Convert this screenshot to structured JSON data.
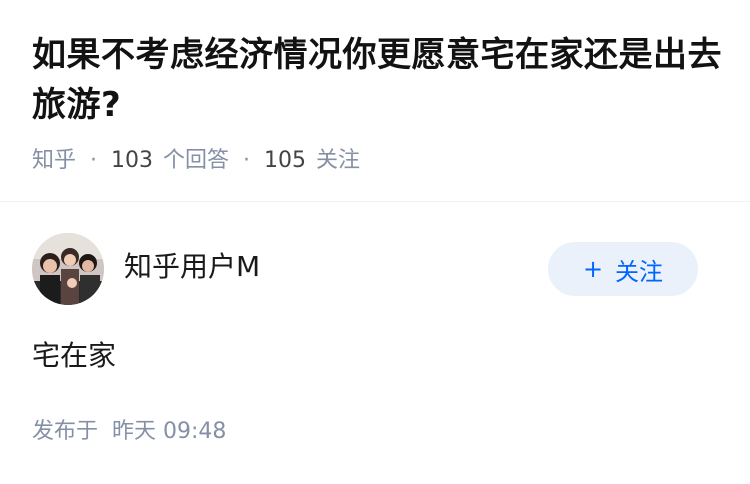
{
  "question": {
    "title": "如果不考虑经济情况你更愿意宅在家还是出去旅游?",
    "source": "知乎",
    "answer_count": "103",
    "answer_label": "个回答",
    "follow_count": "105",
    "follow_label": "关注"
  },
  "answer": {
    "author_name": "知乎用户M",
    "follow_button_label": "关注",
    "content": "宅在家",
    "time_label": "发布于",
    "time_value": "昨天 09:48"
  },
  "colors": {
    "accent": "#0066ff",
    "follow_button_bg": "#ebf1fa",
    "meta_gray": "#8590a6"
  },
  "icons": {
    "avatar": "user-avatar-photo",
    "follow_plus": "plus-icon"
  }
}
